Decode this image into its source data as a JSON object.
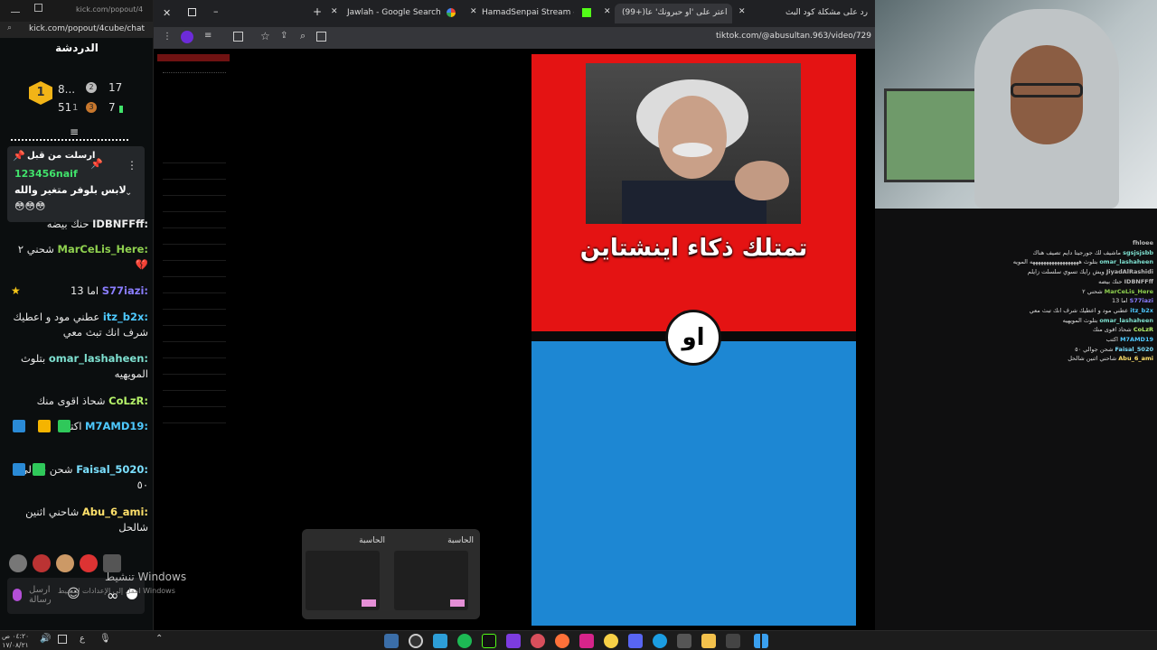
{
  "chat": {
    "titlebar_url": "kick.com/popout/4",
    "url": "kick.com/popout/4cube/chat",
    "header": "الدردشة",
    "leaderboard": [
      {
        "rank": "1",
        "value": "8...",
        "count": "17",
        "rank2": "2"
      },
      {
        "value": "51",
        "sub": "1",
        "rank3": "3",
        "count": "7"
      }
    ],
    "pinned": {
      "title": "ارسلت من قبل",
      "user": "123456naif",
      "text": "لابس بلوفر متغير والله",
      "emojis": "😳😳😳"
    },
    "messages": [
      {
        "user": "IDBNFFff:",
        "text": "حنك بيضه"
      },
      {
        "user": "MarCeLis_Here:",
        "text": "شحني ٢ 💔"
      },
      {
        "user": "S77iazi:",
        "text": "اما 13"
      },
      {
        "user": "itz_b2x:",
        "text": "عطني مود و اعطيك شرف انك تبث معي"
      },
      {
        "user": "omar_lashaheen:",
        "text": "بتلوث المويهيه"
      },
      {
        "user": "CoLzR:",
        "text": "شحاذ اقوى منك"
      },
      {
        "user": "M7AMD19:",
        "text": "اكتب"
      },
      {
        "user": "Faisal_5020:",
        "text": "شحن جوالي ٥٠"
      },
      {
        "user": "Abu_6_ami:",
        "text": "شاحني اثنين شالحل"
      }
    ],
    "input_placeholder": "ارسل رسالة",
    "user_colors": {
      "MarCeLis_Here": "#8fd14f",
      "S77iazi": "#8a7dff",
      "itz_b2x": "#4ec9ff",
      "omar_lashaheen": "#7ee0d0",
      "CoLzR": "#b6f36a",
      "M7AMD19": "#4ec9ff",
      "Faisal_5020": "#7be0ff",
      "Abu_6_ami": "#ffe16b"
    }
  },
  "browser": {
    "tabs": [
      {
        "label": "Jawlah - Google Search"
      },
      {
        "label": "HamadSenpai Stream - Watch"
      },
      {
        "label": "(99+)اعتر على 'او حبرونك' عا"
      },
      {
        "label": "رد على مشكلة كود البث"
      }
    ],
    "address": "tiktok.com/@abusultan.963/video/729"
  },
  "video": {
    "caption": "تمتلك ذكاء اينشتاين",
    "or_label": "او"
  },
  "previews": [
    {
      "title": "الحاسبة"
    },
    {
      "title": "الحاسبة"
    }
  ],
  "overlay_chat": [
    {
      "user": "fhloee",
      "text": ""
    },
    {
      "user": "sgsjsjsbb",
      "text": "ماشيف لك جورجيتا دايم تصيف هناك"
    },
    {
      "user": "omar_lashaheen",
      "text": "بتلوث ههههههههههههههههههه المويه"
    },
    {
      "user": "JiyadAlRashidi",
      "text": "ويش رايك تسوي سلسلت زايلم"
    },
    {
      "user": "IDBNFFff",
      "text": "حنك بيضه"
    },
    {
      "user": "MarCeLis_Here",
      "text": "شحني ٢"
    },
    {
      "user": "S77iazi",
      "text": "اما 13"
    },
    {
      "user": "itz_b2x",
      "text": "عطني مود و اعطيك شرف انك تبث معي"
    },
    {
      "user": "omar_lashaheen",
      "text": "بتلوث المويهيه"
    },
    {
      "user": "CoLzR",
      "text": "شحاذ اقوى منك"
    },
    {
      "user": "M7AMD19",
      "text": "اكتب"
    },
    {
      "user": "Faisal_5020",
      "text": "شحن جوالي ٥٠"
    },
    {
      "user": "Abu_6_ami",
      "text": "شاحني اثنين شالحل"
    }
  ],
  "system": {
    "activate_title": "تنشيط Windows",
    "activate_sub": "انتقل إلى الإعدادات لتنشيط Windows",
    "clock_time": "٠٤:٢٠ ص",
    "clock_date": "١٧/٠٨/٢١"
  }
}
